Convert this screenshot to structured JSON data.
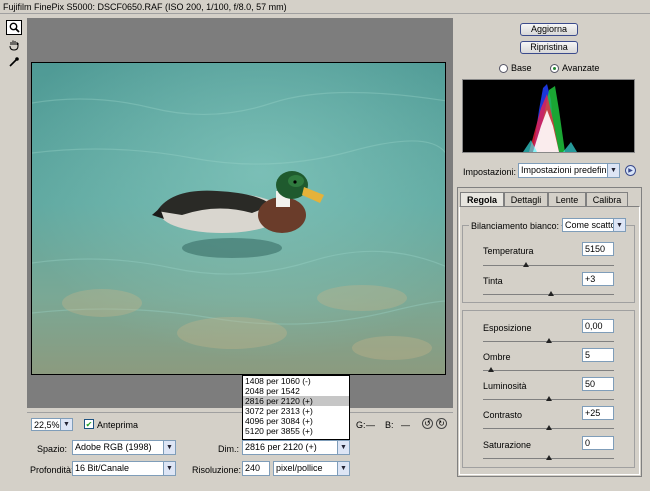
{
  "window": {
    "title": "Fujifilm FinePix S5000:  DSCF0650.RAF  (ISO 200, 1/100, f/8.0, 57 mm)"
  },
  "toolbox": {
    "tools": [
      "zoom-icon",
      "hand-icon",
      "eyedropper-icon"
    ]
  },
  "buttons": {
    "update": "Aggiorna",
    "reset": "Ripristina"
  },
  "mode": {
    "basic": "Base",
    "advanced": "Avanzate",
    "selected": "Avanzate"
  },
  "settings": {
    "label": "Impostazioni:",
    "value": "Impostazioni predefin"
  },
  "tabs": [
    {
      "label": "Regola",
      "active": true
    },
    {
      "label": "Dettagli",
      "active": false
    },
    {
      "label": "Lente",
      "active": false
    },
    {
      "label": "Calibra",
      "active": false
    }
  ],
  "white_balance": {
    "label": "Bilanciamento bianco:",
    "value": "Come scatto"
  },
  "temp": {
    "label": "Temperatura",
    "value": "5150",
    "level": 0.33
  },
  "tint": {
    "label": "Tinta",
    "value": "+3",
    "level": 0.52
  },
  "exposure": {
    "label": "Esposizione",
    "value": "0,00",
    "level": 0.5
  },
  "shadows": {
    "label": "Ombre",
    "value": "5",
    "level": 0.06
  },
  "brightness": {
    "label": "Luminosità",
    "value": "50",
    "level": 0.5
  },
  "contrast": {
    "label": "Contrasto",
    "value": "+25",
    "level": 0.5
  },
  "saturation": {
    "label": "Saturazione",
    "value": "0",
    "level": 0.5
  },
  "bottom": {
    "zoom": "22,5%",
    "preview_label": "Anteprima",
    "preview_checked": true,
    "g_label": "G:",
    "g_value": "—",
    "b_label": "B:",
    "b_value": "—",
    "space_label": "Spazio:",
    "space_value": "Adobe RGB (1998)",
    "depth_label": "Profondità:",
    "depth_value": "16 Bit/Canale",
    "size_label": "Dim.:",
    "size_value": "2816 per 2120  (+)",
    "res_label": "Risoluzione:",
    "res_value": "240",
    "res_unit": "pixel/pollice"
  },
  "size_options": [
    {
      "label": "1408 per 1060  (-)",
      "selected": false
    },
    {
      "label": "2048 per 1542",
      "selected": false
    },
    {
      "label": "2816 per 2120  (+)",
      "selected": true
    },
    {
      "label": "3072 per 2313  (+)",
      "selected": false
    },
    {
      "label": "4096 per 3084  (+)",
      "selected": false
    },
    {
      "label": "5120 per 3855  (+)",
      "selected": false
    }
  ],
  "colors": {
    "accent": "#3b4b8c",
    "panel": "#d4d0c8",
    "preview_bg": "#7d7d7d"
  }
}
